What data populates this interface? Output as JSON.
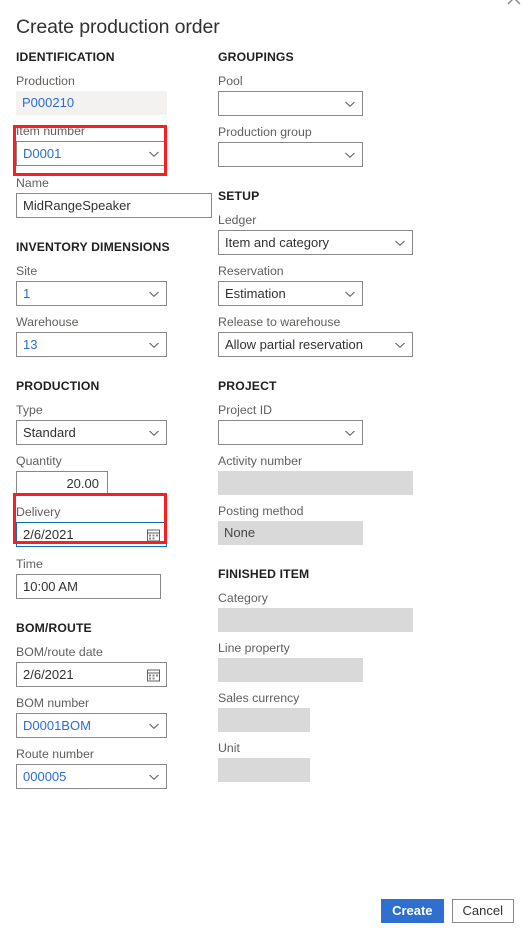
{
  "dialog": {
    "title": "Create production order",
    "close_icon": "close-icon"
  },
  "left_column": {
    "groups": [
      {
        "heading": "IDENTIFICATION",
        "fields": [
          {
            "label": "Production",
            "value": "P000210",
            "type": "flat-readonly"
          },
          {
            "label": "Item number",
            "value": "D0001",
            "type": "combobox"
          },
          {
            "label": "Name",
            "value": "MidRangeSpeaker",
            "type": "text"
          }
        ]
      },
      {
        "heading": "INVENTORY DIMENSIONS",
        "fields": [
          {
            "label": "Site",
            "value": "1",
            "type": "combobox"
          },
          {
            "label": "Warehouse",
            "value": "13",
            "type": "combobox"
          }
        ]
      },
      {
        "heading": "PRODUCTION",
        "fields": [
          {
            "label": "Type",
            "value": "Standard",
            "type": "combobox"
          },
          {
            "label": "Quantity",
            "value": "20.00",
            "type": "number"
          },
          {
            "label": "Delivery",
            "value": "2/6/2021",
            "type": "date"
          },
          {
            "label": "Time",
            "value": "10:00 AM",
            "type": "text"
          }
        ]
      },
      {
        "heading": "BOM/ROUTE",
        "fields": [
          {
            "label": "BOM/route date",
            "value": "2/6/2021",
            "type": "date"
          },
          {
            "label": "BOM number",
            "value": "D0001BOM",
            "type": "combobox"
          },
          {
            "label": "Route number",
            "value": "000005",
            "type": "combobox"
          }
        ]
      }
    ]
  },
  "right_column": {
    "groups": [
      {
        "heading": "GROUPINGS",
        "fields": [
          {
            "label": "Pool",
            "value": "",
            "type": "combobox"
          },
          {
            "label": "Production group",
            "value": "",
            "type": "combobox"
          }
        ]
      },
      {
        "heading": "SETUP",
        "fields": [
          {
            "label": "Ledger",
            "value": "Item and category",
            "type": "combobox"
          },
          {
            "label": "Reservation",
            "value": "Estimation",
            "type": "combobox"
          },
          {
            "label": "Release to warehouse",
            "value": "Allow partial reservation",
            "type": "combobox"
          }
        ]
      },
      {
        "heading": "PROJECT",
        "fields": [
          {
            "label": "Project ID",
            "value": "",
            "type": "combobox"
          },
          {
            "label": "Activity number",
            "value": "",
            "type": "disabled"
          },
          {
            "label": "Posting method",
            "value": "None",
            "type": "disabled"
          }
        ]
      },
      {
        "heading": "FINISHED ITEM",
        "fields": [
          {
            "label": "Category",
            "value": "",
            "type": "disabled"
          },
          {
            "label": "Line property",
            "value": "",
            "type": "disabled"
          },
          {
            "label": "Sales currency",
            "value": "",
            "type": "disabled"
          },
          {
            "label": "Unit",
            "value": "",
            "type": "disabled"
          }
        ]
      }
    ]
  },
  "footer": {
    "create_label": "Create",
    "cancel_label": "Cancel"
  },
  "annotations": {
    "highlight_color": "#fa1e1e",
    "boxes": [
      "item-number-field",
      "delivery-field"
    ]
  },
  "icons": {
    "chevron": "chevron-down-icon",
    "calendar": "calendar-icon"
  }
}
